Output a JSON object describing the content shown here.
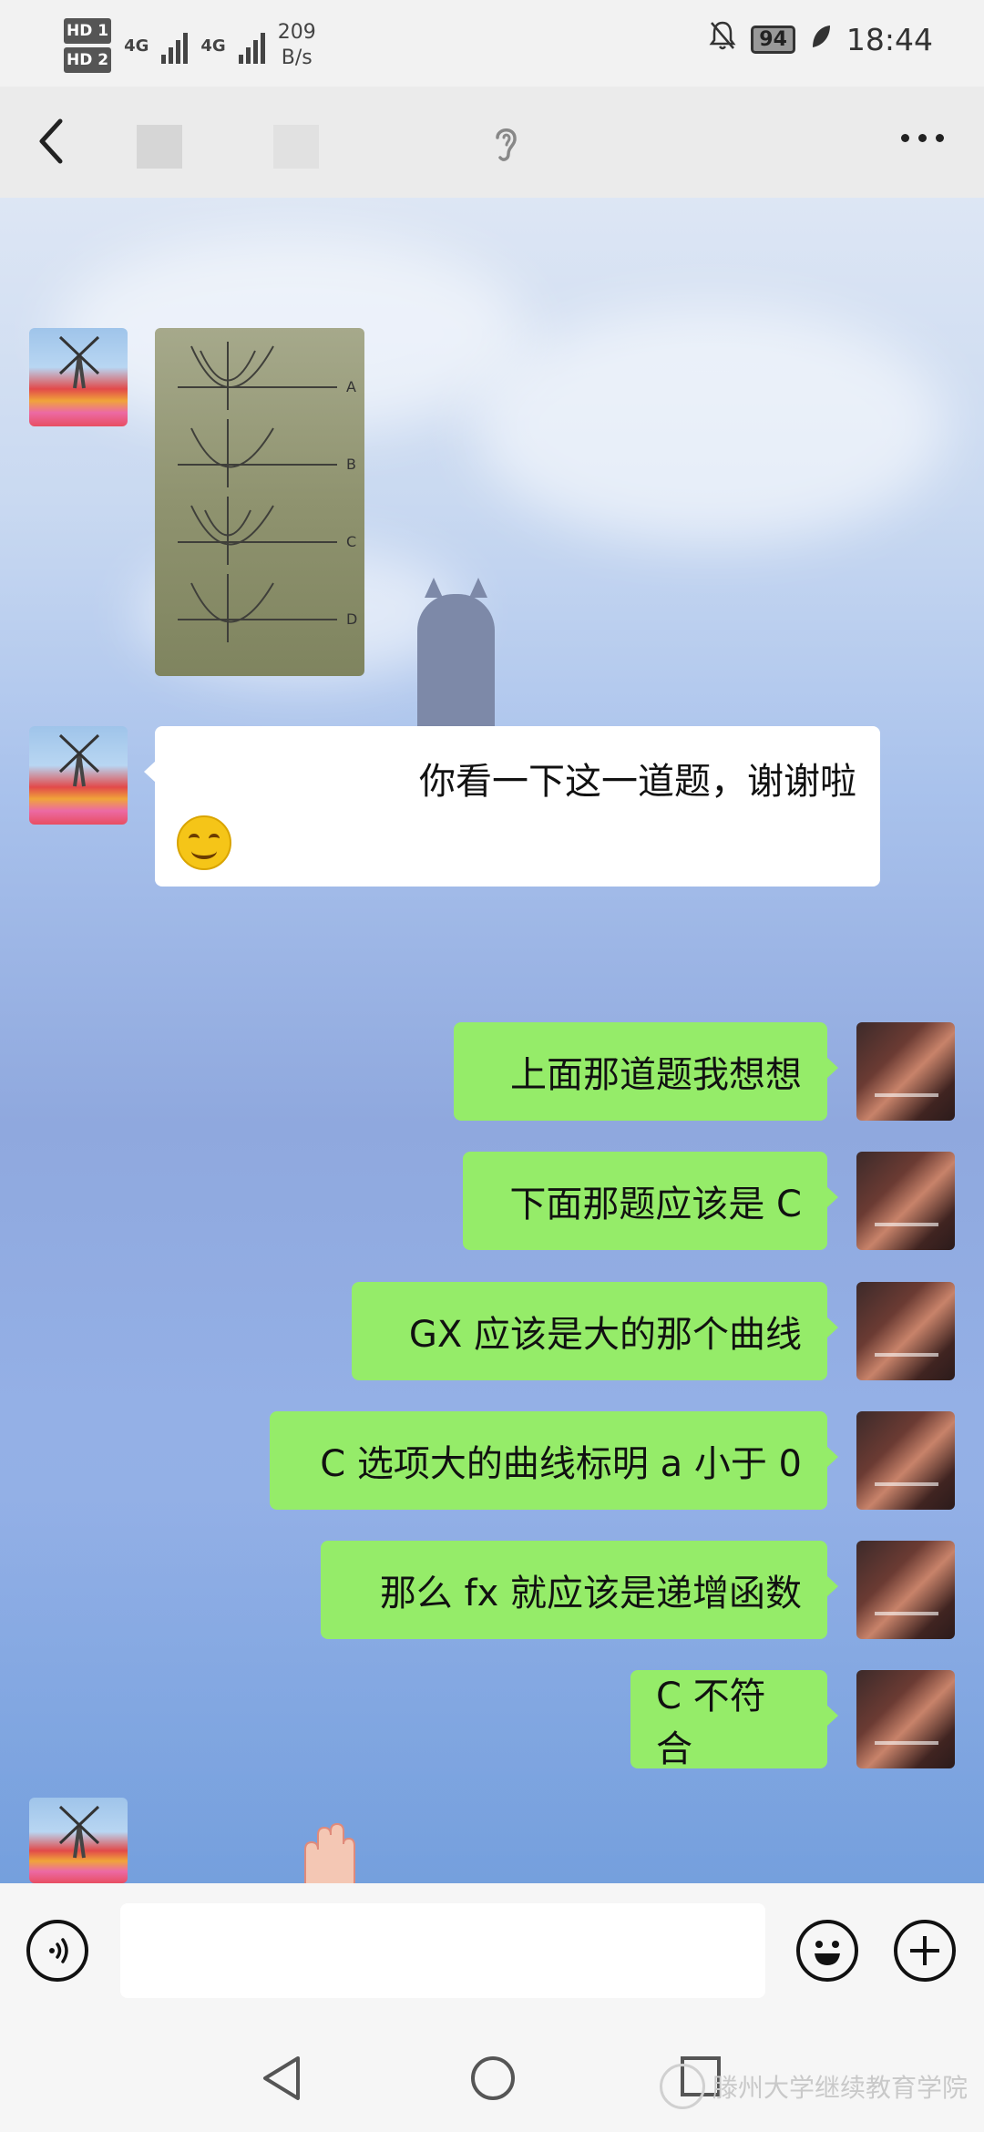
{
  "status_bar": {
    "hd1": "HD 1",
    "hd2": "HD 2",
    "net1": "4G",
    "net2": "4G",
    "speed_value": "209",
    "speed_unit": "B/s",
    "battery": "94",
    "time": "18:44"
  },
  "chat": {
    "incoming": [
      {
        "text": "你看一下这一道题，谢谢啦"
      }
    ],
    "outgoing": [
      "上面那道题我想想",
      "下面那题应该是 C",
      "GX 应该是大的那个曲线",
      "C 选项大的曲线标明 a 小于 0",
      "那么 fx 就应该是递增函数",
      "C 不符合"
    ]
  },
  "photo_labels": [
    "A",
    "B",
    "C",
    "D"
  ],
  "watermark": "滕州大学继续教育学院",
  "colors": {
    "outgoing_bubble": "#95ec69",
    "incoming_bubble": "#ffffff",
    "bar_bg": "#f6f6f6"
  }
}
